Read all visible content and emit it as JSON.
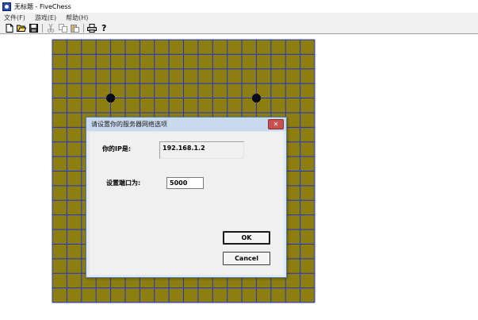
{
  "window": {
    "title": "无标题 - FiveChess"
  },
  "menu": [
    "文件(F)",
    "游戏(E)",
    "帮助(H)"
  ],
  "toolbar": {
    "icons": [
      "new-file-icon",
      "open-folder-icon",
      "save-icon",
      "cut-icon",
      "copy-icon",
      "paste-icon",
      "print-icon",
      "help-icon"
    ]
  },
  "board": {
    "size": 18,
    "board_color": "#8c7e10",
    "line_color": "#2233cc",
    "stones": [
      {
        "color": "black",
        "col": 4,
        "row": 4
      },
      {
        "color": "black",
        "col": 14,
        "row": 4
      }
    ]
  },
  "dialog": {
    "title": "请设置你的服务器网络选项",
    "close_label": "✕",
    "ip_label": "你的IP是:",
    "ip_value": "192.168.1.2",
    "port_label": "设置端口为:",
    "port_value": "5000",
    "ok_label": "OK",
    "cancel_label": "Cancel"
  }
}
